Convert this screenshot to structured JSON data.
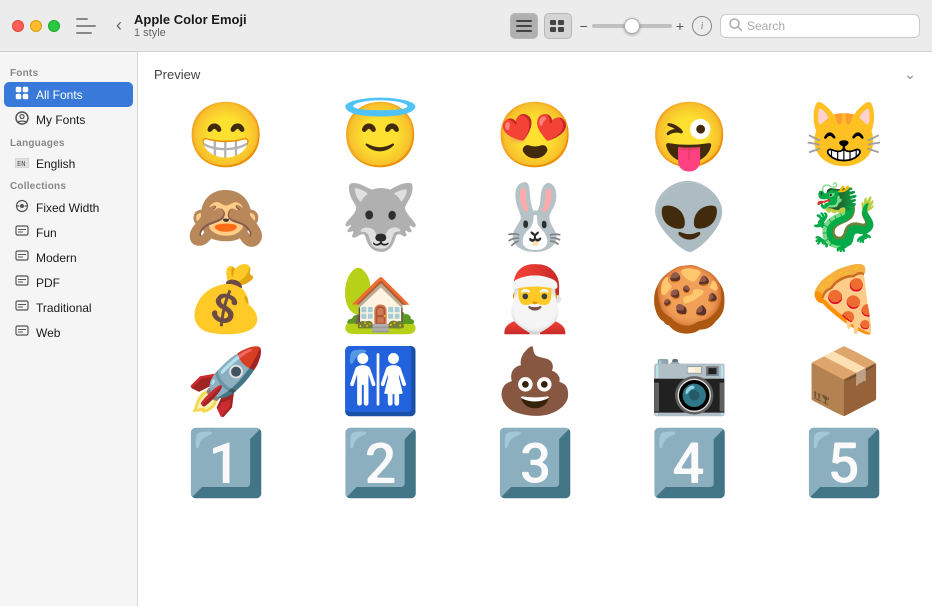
{
  "titlebar": {
    "font_name": "Apple Color Emoji",
    "font_subtitle": "1 style",
    "search_placeholder": "Search"
  },
  "toolbar": {
    "list_view_label": "≡",
    "grid_view_label": "⊟",
    "slider_min": "−",
    "slider_max": "+",
    "info_label": "i"
  },
  "sidebar": {
    "fonts_label": "Fonts",
    "all_fonts_label": "All Fonts",
    "my_fonts_label": "My Fonts",
    "languages_label": "Languages",
    "english_label": "English",
    "collections_label": "Collections",
    "fixed_width_label": "Fixed Width",
    "fun_label": "Fun",
    "modern_label": "Modern",
    "pdf_label": "PDF",
    "traditional_label": "Traditional",
    "web_label": "Web"
  },
  "content": {
    "preview_label": "Preview",
    "emojis": [
      "😁",
      "😇",
      "😍",
      "😜",
      "😸",
      "🙈",
      "🐺",
      "🐰",
      "👽",
      "🐉",
      "💰",
      "🏡",
      "🎅",
      "🍪",
      "🍕",
      "🚀",
      "🚻",
      "💩",
      "📷",
      "📦",
      "1️⃣",
      "2️⃣",
      "3️⃣",
      "4️⃣",
      "5️⃣"
    ]
  },
  "colors": {
    "active_sidebar": "#3879d9",
    "titlebar_bg": "#ececec"
  }
}
